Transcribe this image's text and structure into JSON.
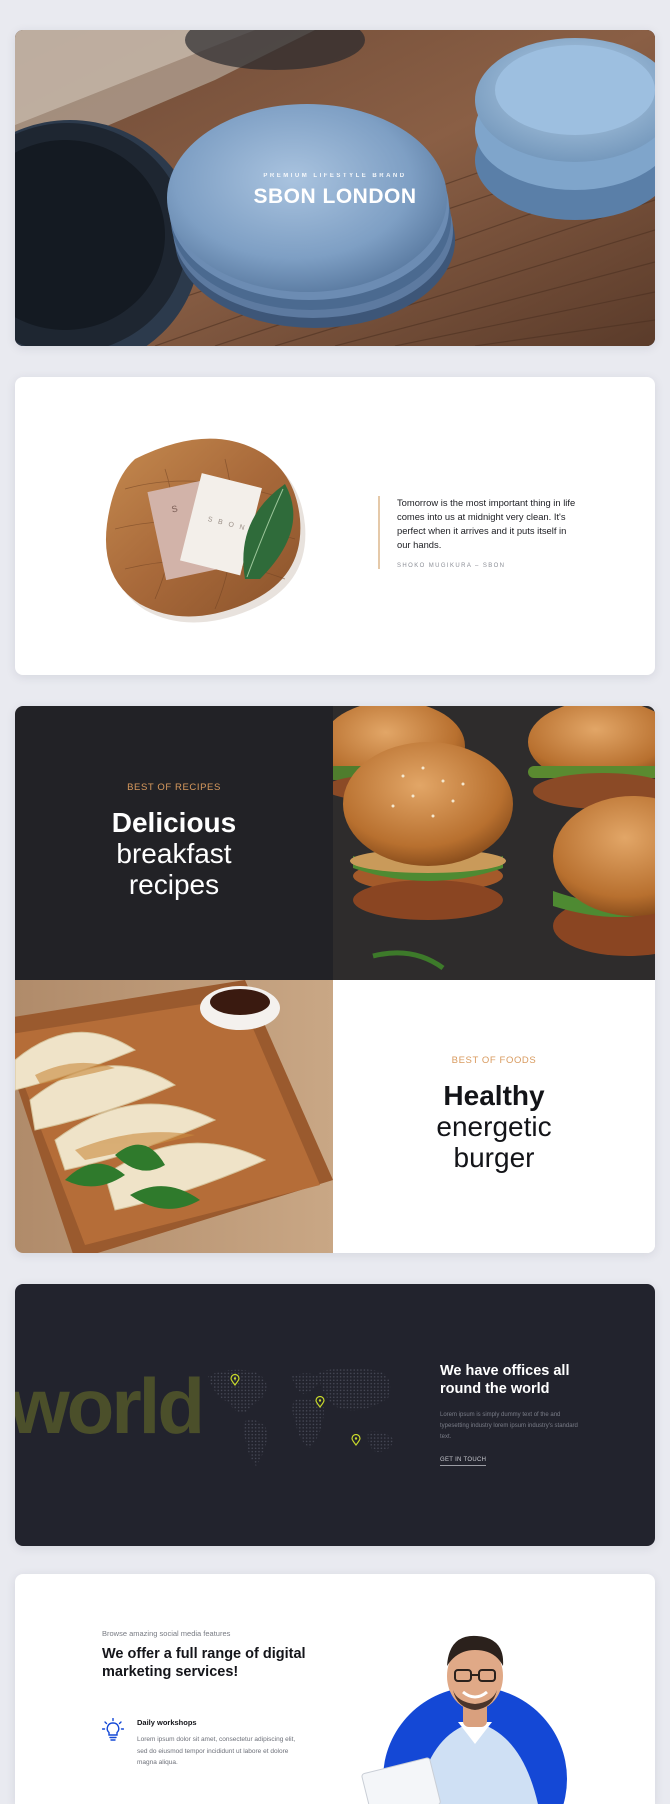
{
  "hero": {
    "kicker": "PREMIUM LIFESTYLE BRAND",
    "title": "SBON LONDON"
  },
  "quote": {
    "text": "Tomorrow is the most important thing in life comes into us at midnight very clean. It's perfect when it arrives and it puts itself in our hands.",
    "author": "SHOKO MUGIKURA – SBON",
    "card_letters": "S B O N",
    "card_mark": "S",
    "accent_color": "#e5c9a9"
  },
  "recipes": {
    "top_left": {
      "kicker": "BEST OF RECIPES",
      "title_bold": "Delicious",
      "title_line2": "breakfast",
      "title_line3": "recipes"
    },
    "bottom_right": {
      "kicker": "BEST OF FOODS",
      "title_bold": "Healthy",
      "title_line2": "energetic",
      "title_line3": "burger"
    },
    "kicker_color": "#d89a5e"
  },
  "world": {
    "watermark": "world",
    "title": "We have offices all round the world",
    "body": "Lorem ipsum is simply dummy text of the and typesetting industry lorem ipsum industry's standard text.",
    "link": "GET IN TOUCH",
    "pin_color": "#c8d92b"
  },
  "services": {
    "kicker": "Browse amazing social media features",
    "title": "We offer a full range of digital marketing services!",
    "feature": {
      "icon": "lightbulb-icon",
      "title": "Daily workshops",
      "body": "Lorem ipsum dolor sit amet, consectetur adipiscing elit, sed do eiusmod tempor incididunt ut labore et dolore magna aliqua."
    },
    "accent_color": "#1448d6"
  }
}
